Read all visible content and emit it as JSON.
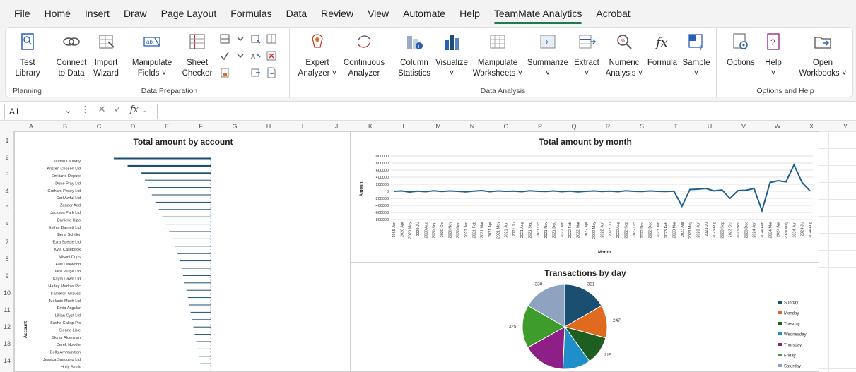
{
  "menu": {
    "items": [
      "File",
      "Home",
      "Insert",
      "Draw",
      "Page Layout",
      "Formulas",
      "Data",
      "Review",
      "View",
      "Automate",
      "Help",
      "TeamMate Analytics",
      "Acrobat"
    ],
    "active": "TeamMate Analytics"
  },
  "ribbon": {
    "groups": {
      "planning": "Planning",
      "data_preparation": "Data Preparation",
      "data_analysis": "Data Analysis",
      "options_help": "Options and Help"
    },
    "buttons": {
      "test_library": [
        "Test",
        "Library"
      ],
      "connect_to_data": [
        "Connect",
        "to Data"
      ],
      "import_wizard": [
        "Import",
        "Wizard"
      ],
      "manipulate_fields": [
        "Manipulate",
        "Fields ˅"
      ],
      "sheet_checker": [
        "Sheet",
        "Checker"
      ],
      "expert_analyzer": [
        "Expert",
        "Analyzer ˅"
      ],
      "continuous_analyzer": [
        "Continuous",
        "Analyzer"
      ],
      "column_statistics": [
        "Column",
        "Statistics"
      ],
      "visualize": [
        "Visualize",
        "˅"
      ],
      "manipulate_worksheets": [
        "Manipulate",
        "Worksheets ˅"
      ],
      "summarize": [
        "Summarize",
        "˅"
      ],
      "extract": [
        "Extract",
        "˅"
      ],
      "numeric_analysis": [
        "Numeric",
        "Analysis ˅"
      ],
      "formula": [
        "Formula",
        ""
      ],
      "sample": [
        "Sample",
        "˅"
      ],
      "options": [
        "Options",
        ""
      ],
      "help": [
        "Help",
        "˅"
      ],
      "open_workbooks": [
        "Open",
        "Workbooks ˅"
      ]
    }
  },
  "formula_bar": {
    "name_box": "A1",
    "fx": "fx",
    "value": ""
  },
  "columns": [
    "A",
    "B",
    "C",
    "D",
    "E",
    "F",
    "G",
    "H",
    "I",
    "J",
    "K",
    "L",
    "M",
    "N",
    "O",
    "P",
    "Q",
    "R",
    "S",
    "T",
    "U",
    "V",
    "W",
    "X",
    "Y"
  ],
  "rows": [
    "1",
    "2",
    "3",
    "4",
    "5",
    "6",
    "7",
    "8",
    "9",
    "10",
    "11",
    "12",
    "13",
    "14"
  ],
  "chart_data": [
    {
      "type": "bar",
      "title": "Total amount by account",
      "ylabel": "Account",
      "xlabel": "",
      "categories": [
        "Jaiden Laundry",
        "Kristen Chosen Ltd",
        "Emiliano Depute",
        "Dune Pray Ltd",
        "Graham Posey Ltd",
        "Carl Awful Ltd",
        "Zander Add",
        "Jackson Park Ltd",
        "Danielle Hipo",
        "Esther Barnett Ltd",
        "Siena Schiller",
        "Ezra Specie Ltd",
        "Kyla Casebook",
        "Misael Drips",
        "Ellis Oakwood",
        "Jake Purge Ltd",
        "Kayla Dawn Ltd",
        "Harley Madras Plc",
        "Kameron Graves",
        "Melanie Much Ltd",
        "Emia Angular",
        "Lillian Cyst Ltd",
        "Sasha Gallup Plc",
        "Sienna Lisle",
        "Skylar Alderman",
        "Derek Noodle",
        "Bella Ammunition",
        "Jessica Snagging Ltd",
        "Holly Stock"
      ],
      "values": [
        -140,
        -120,
        -100,
        -95,
        -90,
        -85,
        -80,
        -75,
        -70,
        -65,
        -60,
        -56,
        -52,
        -48,
        -45,
        -42,
        -40,
        -38,
        -35,
        -33,
        -31,
        -29,
        -27,
        -25,
        -23,
        -21,
        -19,
        -17,
        -15
      ]
    },
    {
      "type": "line",
      "title": "Total amount by month",
      "xlabel": "Month",
      "ylabel": "Amount",
      "ylim": [
        -800000,
        1000000
      ],
      "yticks": [
        "1000000",
        "800000",
        "600000",
        "400000",
        "200000",
        "0",
        "-200000",
        "-400000",
        "-600000",
        "-800000"
      ],
      "x": [
        "1965 Jan",
        "2020 Apr",
        "2020 May",
        "2020 Jul",
        "2020 Aug",
        "2020 Sep",
        "2020 Oct",
        "2020 Nov",
        "2020 Dec",
        "2021 Jan",
        "2021 Feb",
        "2021 Mar",
        "2021 Apr",
        "2021 May",
        "2021 Jun",
        "2021 Jul",
        "2021 Aug",
        "2021 Sep",
        "2021 Oct",
        "2021 Nov",
        "2021 Dec",
        "2022 Jan",
        "2022 Feb",
        "2022 Mar",
        "2022 Apr",
        "2022 May",
        "2022 Jun",
        "2022 Jul",
        "2022 Aug",
        "2022 Sep",
        "2022 Oct",
        "2022 Nov",
        "2022 Dec",
        "2023 Jan",
        "2023 Feb",
        "2023 Mar",
        "2023 Apr",
        "2023 May",
        "2023 Jun",
        "2023 Jul",
        "2023 Aug",
        "2023 Sep",
        "2023 Oct",
        "2023 Nov",
        "2023 Dec",
        "2024 Jan",
        "2024 Feb",
        "2024 Mar",
        "2024 Apr",
        "2024 May",
        "2024 Jun",
        "2024 Jul",
        "2024 Aug"
      ],
      "values": [
        0,
        10000,
        -20000,
        5000,
        -10000,
        15000,
        -5000,
        10000,
        0,
        -15000,
        5000,
        20000,
        -10000,
        10000,
        0,
        5000,
        -10000,
        15000,
        0,
        -5000,
        10000,
        -10000,
        5000,
        -15000,
        0,
        10000,
        -5000,
        5000,
        -10000,
        15000,
        0,
        -5000,
        10000,
        0,
        -5000,
        5000,
        -420000,
        50000,
        60000,
        80000,
        10000,
        40000,
        -200000,
        20000,
        30000,
        80000,
        -550000,
        250000,
        300000,
        270000,
        750000,
        250000,
        10000
      ]
    },
    {
      "type": "pie",
      "title": "Transactions by day",
      "categories": [
        "Sunday",
        "Monday",
        "Tuesday",
        "Wednesday",
        "Thursday",
        "Friday",
        "Saturday"
      ],
      "values": [
        331,
        247,
        215,
        210,
        320,
        325,
        330
      ],
      "colors": [
        "#1b4f72",
        "#e06a1f",
        "#1e5e20",
        "#1f8fc9",
        "#8e1f86",
        "#3e9d2a",
        "#8ea3bf"
      ],
      "visible_labels": {
        "0": "331",
        "1": "247",
        "2": "215",
        "5": "325",
        "6": "330"
      }
    }
  ]
}
